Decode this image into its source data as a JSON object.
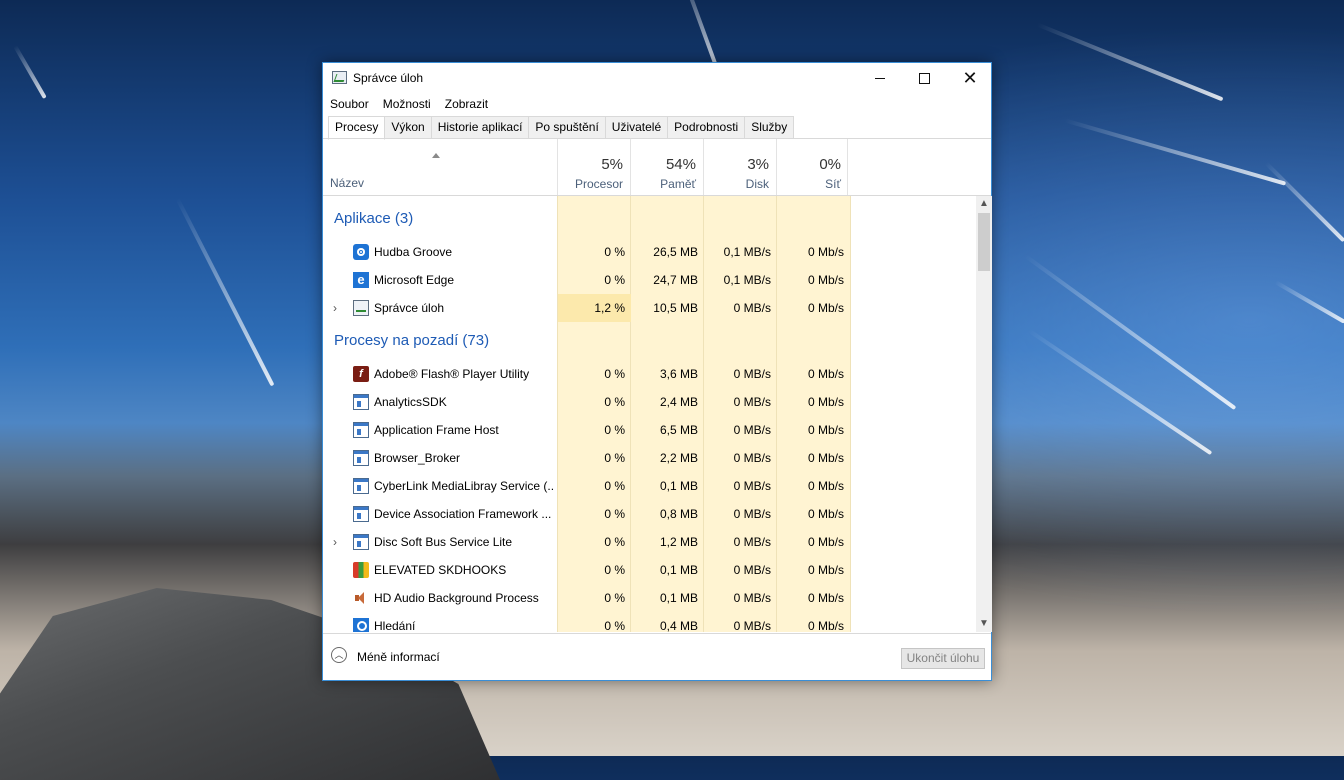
{
  "window": {
    "title": "Správce úloh"
  },
  "menu": [
    "Soubor",
    "Možnosti",
    "Zobrazit"
  ],
  "tabs": [
    "Procesy",
    "Výkon",
    "Historie aplikací",
    "Po spuštění",
    "Uživatelé",
    "Podrobnosti",
    "Služby"
  ],
  "active_tab": "Procesy",
  "columns": {
    "name": "Název",
    "cpu": {
      "pct": "5%",
      "label": "Procesor"
    },
    "mem": {
      "pct": "54%",
      "label": "Paměť"
    },
    "disk": {
      "pct": "3%",
      "label": "Disk"
    },
    "net": {
      "pct": "0%",
      "label": "Síť"
    }
  },
  "groups": {
    "apps": "Aplikace (3)",
    "background": "Procesy na pozadí (73)"
  },
  "apps": [
    {
      "name": "Hudba Groove",
      "cpu": "0 %",
      "mem": "26,5 MB",
      "disk": "0,1 MB/s",
      "net": "0 Mb/s",
      "icon": "groove-icon"
    },
    {
      "name": "Microsoft Edge",
      "cpu": "0 %",
      "mem": "24,7 MB",
      "disk": "0,1 MB/s",
      "net": "0 Mb/s",
      "icon": "edge-icon"
    },
    {
      "name": "Správce úloh",
      "cpu": "1,2 %",
      "mem": "10,5 MB",
      "disk": "0 MB/s",
      "net": "0 Mb/s",
      "icon": "task-manager-icon"
    }
  ],
  "background": [
    {
      "name": "Adobe® Flash® Player Utility",
      "cpu": "0 %",
      "mem": "3,6 MB",
      "disk": "0 MB/s",
      "net": "0 Mb/s",
      "icon": "flash-icon"
    },
    {
      "name": "AnalyticsSDK",
      "cpu": "0 %",
      "mem": "2,4 MB",
      "disk": "0 MB/s",
      "net": "0 Mb/s",
      "icon": "window-icon"
    },
    {
      "name": "Application Frame Host",
      "cpu": "0 %",
      "mem": "6,5 MB",
      "disk": "0 MB/s",
      "net": "0 Mb/s",
      "icon": "window-icon"
    },
    {
      "name": "Browser_Broker",
      "cpu": "0 %",
      "mem": "2,2 MB",
      "disk": "0 MB/s",
      "net": "0 Mb/s",
      "icon": "window-icon"
    },
    {
      "name": "CyberLink MediaLibray Service (...",
      "cpu": "0 %",
      "mem": "0,1 MB",
      "disk": "0 MB/s",
      "net": "0 Mb/s",
      "icon": "window-icon"
    },
    {
      "name": "Device Association Framework ...",
      "cpu": "0 %",
      "mem": "0,8 MB",
      "disk": "0 MB/s",
      "net": "0 Mb/s",
      "icon": "window-icon"
    },
    {
      "name": "Disc Soft Bus Service Lite",
      "cpu": "0 %",
      "mem": "1,2 MB",
      "disk": "0 MB/s",
      "net": "0 Mb/s",
      "icon": "window-icon"
    },
    {
      "name": "ELEVATED SKDHOOKS",
      "cpu": "0 %",
      "mem": "0,1 MB",
      "disk": "0 MB/s",
      "net": "0 Mb/s",
      "icon": "elevated-icon"
    },
    {
      "name": "HD Audio Background Process",
      "cpu": "0 %",
      "mem": "0,1 MB",
      "disk": "0 MB/s",
      "net": "0 Mb/s",
      "icon": "speaker-icon"
    },
    {
      "name": "Hledání",
      "cpu": "0 %",
      "mem": "0,4 MB",
      "disk": "0 MB/s",
      "net": "0 Mb/s",
      "icon": "search-icon"
    }
  ],
  "footer": {
    "less_info": "Méně informací",
    "end_task": "Ukončit úlohu"
  },
  "colors": {
    "accent": "#1e5bb5",
    "tint_light": "#fff4d2",
    "tint_dark": "#fce9ac"
  }
}
